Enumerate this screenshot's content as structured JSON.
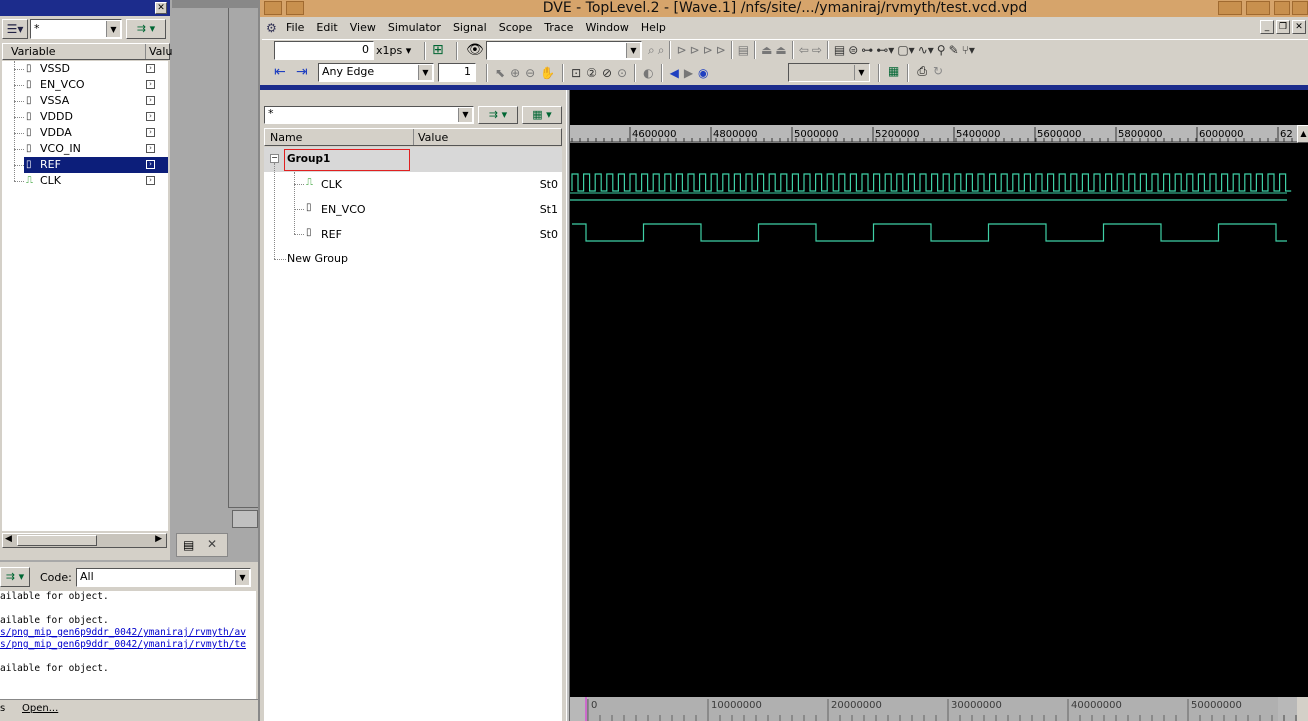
{
  "window": {
    "title": "DVE - TopLevel.2 - [Wave.1]  /nfs/site/.../ymaniraj/rvmyth/test.vcd.vpd"
  },
  "menu": [
    "File",
    "Edit",
    "View",
    "Simulator",
    "Signal",
    "Scope",
    "Trace",
    "Window",
    "Help"
  ],
  "toolbar": {
    "time_value": "0",
    "time_unit": "x1ps",
    "edge_select": "Any Edge",
    "edge_count": "1"
  },
  "left_panel": {
    "filter": "*",
    "columns": {
      "variable": "Variable",
      "value": "Valu"
    },
    "variables": [
      {
        "name": "VSSD",
        "type": "bus"
      },
      {
        "name": "EN_VCO",
        "type": "bus"
      },
      {
        "name": "VSSA",
        "type": "bus"
      },
      {
        "name": "VDDD",
        "type": "bus"
      },
      {
        "name": "VDDA",
        "type": "bus"
      },
      {
        "name": "VCO_IN",
        "type": "bus"
      },
      {
        "name": "REF",
        "type": "bus",
        "selected": true
      },
      {
        "name": "CLK",
        "type": "clock"
      }
    ]
  },
  "console": {
    "code_label": "Code:",
    "code_value": "All",
    "lines": [
      {
        "text": "ailable for object.",
        "link": false
      },
      {
        "text": "",
        "link": false
      },
      {
        "text": "ailable for object.",
        "link": false
      },
      {
        "text": "s/png_mip_gen6p9ddr_0042/ymaniraj/rvmyth/av",
        "link": true
      },
      {
        "text": "s/png_mip_gen6p9ddr_0042/ymaniraj/rvmyth/te",
        "link": true
      },
      {
        "text": "",
        "link": false
      },
      {
        "text": "ailable for object.",
        "link": false
      }
    ],
    "tabs": [
      "s",
      "Open..."
    ]
  },
  "wave": {
    "filter": "*",
    "columns": {
      "name": "Name",
      "value": "Value"
    },
    "group": "Group1",
    "signals": [
      {
        "name": "CLK",
        "value": "St0",
        "type": "clock"
      },
      {
        "name": "EN_VCO",
        "value": "St1",
        "type": "bus"
      },
      {
        "name": "REF",
        "value": "St0",
        "type": "bus"
      }
    ],
    "new_group": "New Group",
    "top_ruler": [
      "4600000",
      "4800000",
      "5000000",
      "5200000",
      "5400000",
      "5600000",
      "5800000",
      "6000000",
      "62"
    ],
    "bottom_ruler": [
      "0",
      "10000000",
      "20000000",
      "30000000",
      "40000000",
      "50000000"
    ],
    "colors": {
      "wave": "#3fd0a6",
      "bg": "#000000",
      "ruler_bg": "#b8b8b8"
    }
  }
}
